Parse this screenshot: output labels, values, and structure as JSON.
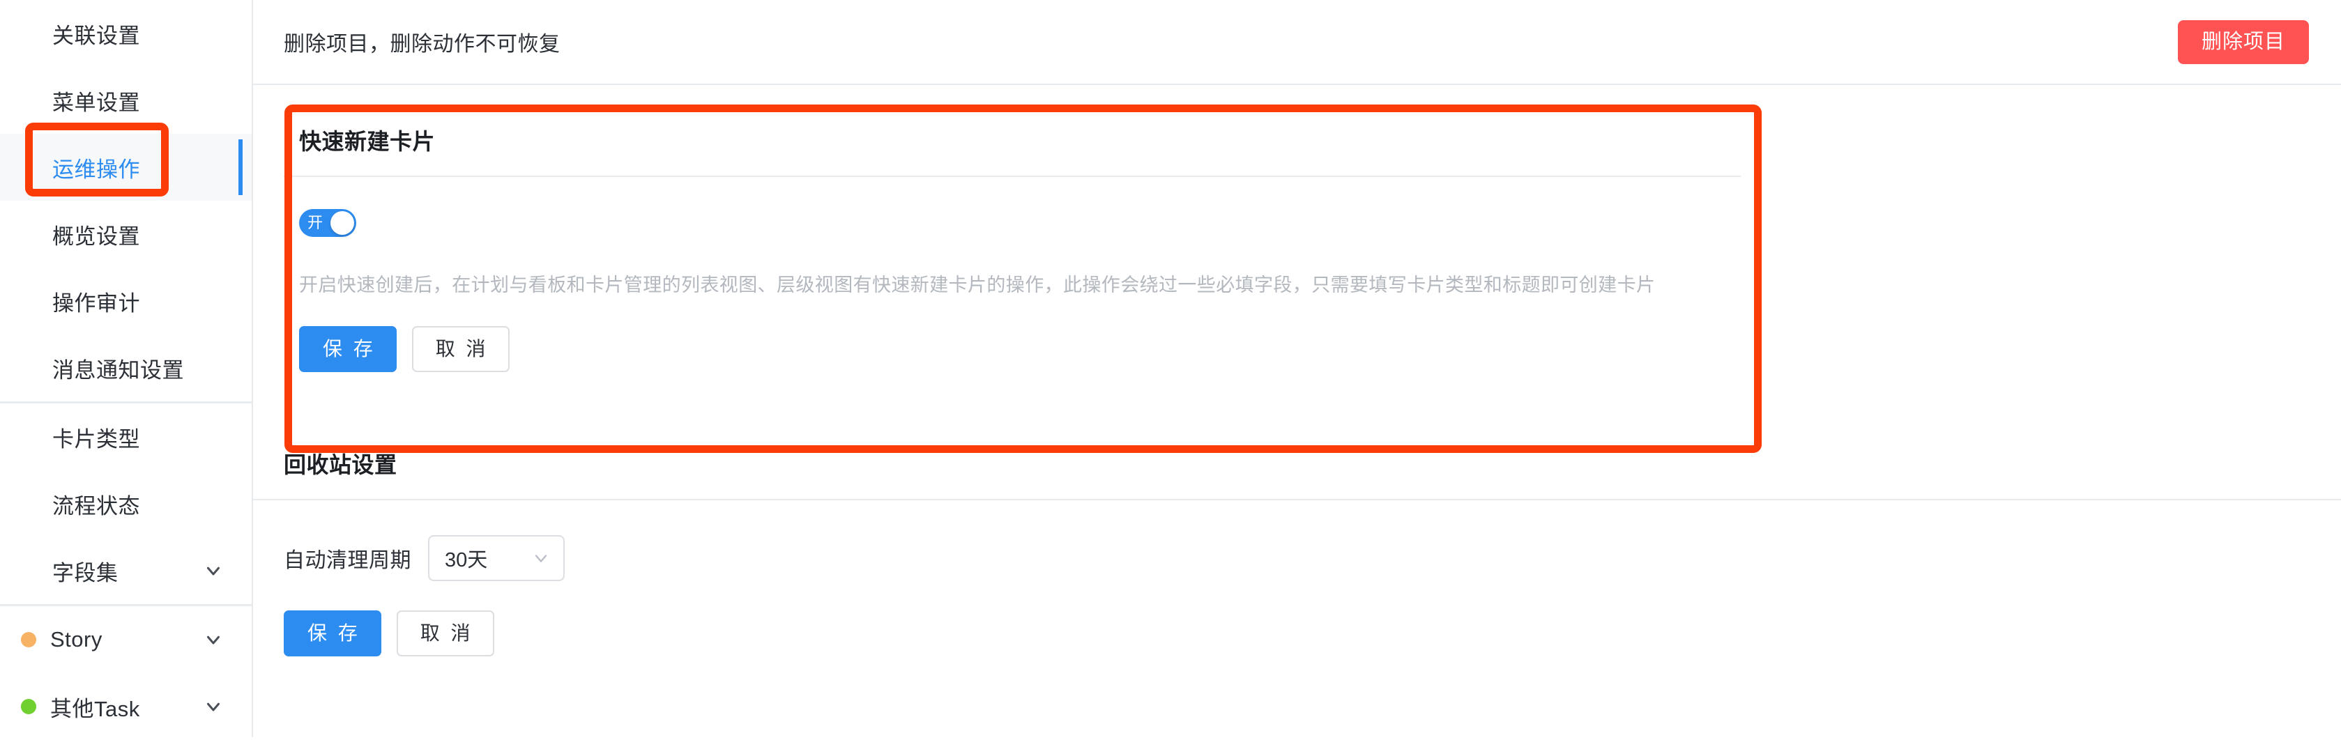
{
  "sidebar": {
    "groups": [
      {
        "items": [
          {
            "label": "关联设置",
            "name": "sidebar-item-relation-settings",
            "active": false,
            "chevron": false,
            "dot": null
          },
          {
            "label": "菜单设置",
            "name": "sidebar-item-menu-settings",
            "active": false,
            "chevron": false,
            "dot": null
          },
          {
            "label": "运维操作",
            "name": "sidebar-item-ops-operations",
            "active": true,
            "chevron": false,
            "dot": null
          },
          {
            "label": "概览设置",
            "name": "sidebar-item-overview-settings",
            "active": false,
            "chevron": false,
            "dot": null
          },
          {
            "label": "操作审计",
            "name": "sidebar-item-audit-log",
            "active": false,
            "chevron": false,
            "dot": null
          },
          {
            "label": "消息通知设置",
            "name": "sidebar-item-notification-settings",
            "active": false,
            "chevron": false,
            "dot": null
          }
        ]
      },
      {
        "items": [
          {
            "label": "卡片类型",
            "name": "sidebar-item-card-type",
            "active": false,
            "chevron": false,
            "dot": null
          },
          {
            "label": "流程状态",
            "name": "sidebar-item-workflow-status",
            "active": false,
            "chevron": false,
            "dot": null
          },
          {
            "label": "字段集",
            "name": "sidebar-item-field-set",
            "active": false,
            "chevron": true,
            "dot": null
          }
        ]
      },
      {
        "items": [
          {
            "label": "Story",
            "name": "sidebar-item-story",
            "active": false,
            "chevron": true,
            "dot": "#f7b264"
          },
          {
            "label": "其他Task",
            "name": "sidebar-item-other-task",
            "active": false,
            "chevron": true,
            "dot": "#6fd02f"
          }
        ]
      }
    ]
  },
  "topbar": {
    "notice": "删除项目，删除动作不可恢复",
    "delete_button": "删除项目"
  },
  "quick_create_card": {
    "title": "快速新建卡片",
    "toggle": {
      "state_label": "开",
      "checked": true
    },
    "hint": "开启快速创建后，在计划与看板和卡片管理的列表视图、层级视图有快速新建卡片的操作，此操作会绕过一些必填字段，只需要填写卡片类型和标题即可创建卡片",
    "save_label": "保 存",
    "cancel_label": "取 消"
  },
  "recycle_bin": {
    "title": "回收站设置",
    "cleanup_label": "自动清理周期",
    "cleanup_value": "30天",
    "save_label": "保 存",
    "cancel_label": "取 消"
  },
  "colors": {
    "primary": "#2d8cf0",
    "danger": "#ff5252",
    "annotation": "#fc3c06",
    "story_dot": "#f7b264",
    "task_dot": "#6fd02f"
  }
}
